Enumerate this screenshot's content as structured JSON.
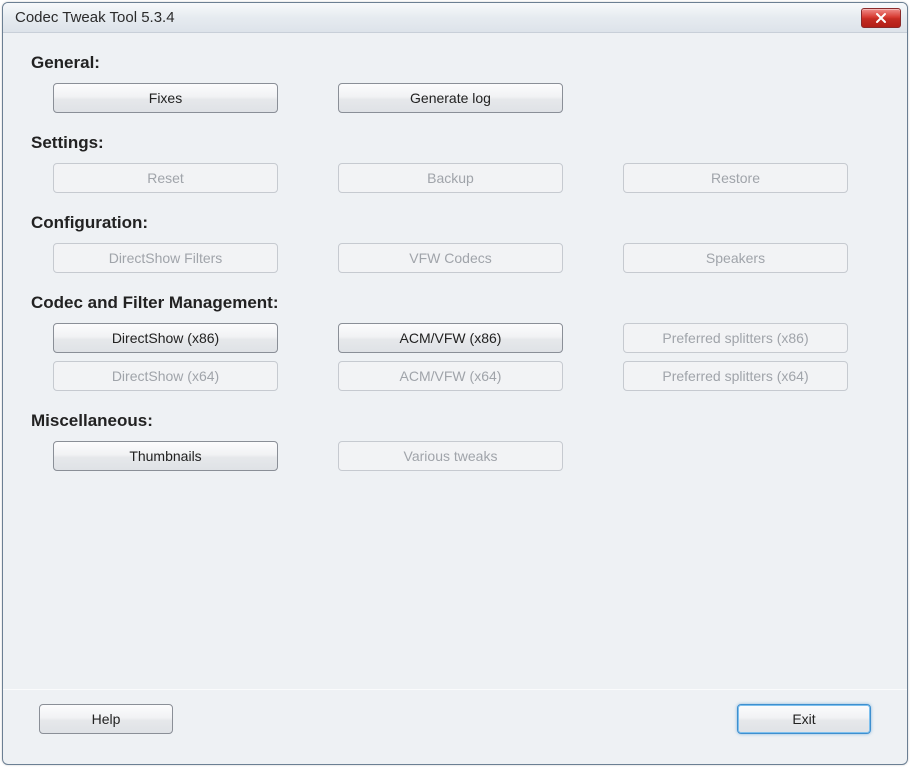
{
  "window": {
    "title": "Codec Tweak Tool 5.3.4"
  },
  "sections": {
    "general": {
      "label": "General:",
      "fixes": "Fixes",
      "generate_log": "Generate log"
    },
    "settings": {
      "label": "Settings:",
      "reset": "Reset",
      "backup": "Backup",
      "restore": "Restore"
    },
    "configuration": {
      "label": "Configuration:",
      "directshow_filters": "DirectShow Filters",
      "vfw_codecs": "VFW Codecs",
      "speakers": "Speakers"
    },
    "codec_mgmt": {
      "label": "Codec and Filter Management:",
      "directshow_x86": "DirectShow  (x86)",
      "acm_vfw_x86": "ACM/VFW  (x86)",
      "pref_split_x86": "Preferred splitters  (x86)",
      "directshow_x64": "DirectShow  (x64)",
      "acm_vfw_x64": "ACM/VFW  (x64)",
      "pref_split_x64": "Preferred splitters  (x64)"
    },
    "misc": {
      "label": "Miscellaneous:",
      "thumbnails": "Thumbnails",
      "various_tweaks": "Various tweaks"
    }
  },
  "footer": {
    "help": "Help",
    "exit": "Exit"
  }
}
